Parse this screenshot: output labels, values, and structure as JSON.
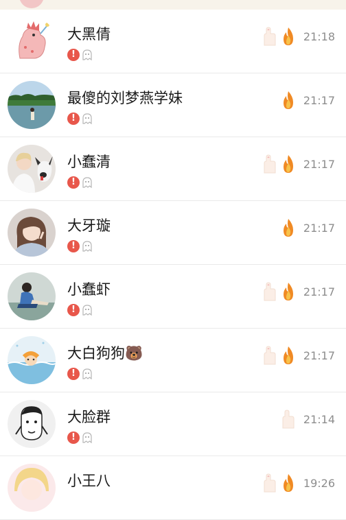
{
  "chats": [
    {
      "name": "大黑倩",
      "time": "21:18",
      "hand": true,
      "flame": true,
      "avatar": "dinosaur-avatar"
    },
    {
      "name": "最傻的刘梦燕学妹",
      "time": "21:17",
      "hand": false,
      "flame": true,
      "avatar": "lake-photo-avatar"
    },
    {
      "name": "小蠢清",
      "time": "21:17",
      "hand": true,
      "flame": true,
      "avatar": "boy-with-dog-avatar"
    },
    {
      "name": "大牙璇",
      "time": "21:17",
      "hand": false,
      "flame": true,
      "avatar": "girl-peace-sign-avatar"
    },
    {
      "name": "小蠢虾",
      "time": "21:17",
      "hand": true,
      "flame": true,
      "avatar": "girl-sitting-avatar"
    },
    {
      "name": "大白狗狗🐻",
      "time": "21:17",
      "hand": true,
      "flame": true,
      "avatar": "swimming-cartoon-avatar"
    },
    {
      "name": "大脸群",
      "time": "21:14",
      "hand": true,
      "flame": false,
      "avatar": "sketch-face-avatar"
    },
    {
      "name": "小王八",
      "time": "19:26",
      "hand": true,
      "flame": true,
      "avatar": "blonde-anime-avatar"
    }
  ],
  "colors": {
    "alert": "#e8574b",
    "flame": "#f08a24",
    "time": "#8d8d8d",
    "divider": "#e9e9e9"
  }
}
